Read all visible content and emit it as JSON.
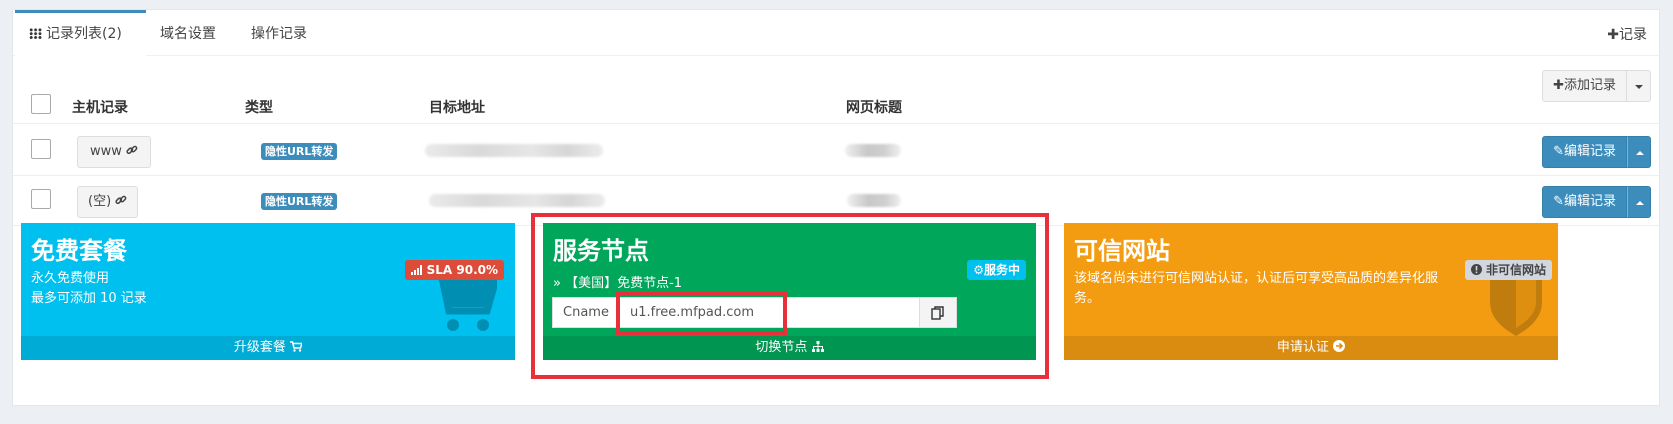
{
  "tabs": {
    "records": "记录列表(2)",
    "domain_settings": "域名设置",
    "operation_log": "操作记录",
    "add_record_link": "记录"
  },
  "table": {
    "headers": [
      "主机记录",
      "类型",
      "目标地址",
      "网页标题"
    ],
    "add_record_button": "添加记录",
    "rows": [
      {
        "host": "www",
        "type": "隐性URL转发",
        "edit_label": "编辑记录"
      },
      {
        "host": "(空)",
        "type": "隐性URL转发",
        "edit_label": "编辑记录"
      }
    ]
  },
  "cards": {
    "free_plan": {
      "title": "免费套餐",
      "line1": "永久免费使用",
      "line2": "最多可添加 10 记录",
      "badge": "SLA 90.0%",
      "footer": "升级套餐",
      "color": "#00c0ef"
    },
    "service_node": {
      "title": "服务节点",
      "node_name": "【美国】免费节点-1",
      "status_badge": "服务中",
      "cname_label": "Cname",
      "cname_value": "u1.free.mfpad.com",
      "footer": "切换节点",
      "color": "#00a65a"
    },
    "trusted_site": {
      "title": "可信网站",
      "desc": "该域名尚未进行可信网站认证，认证后可享受高品质的差异化服务。",
      "badge": "非可信网站",
      "footer": "申请认证",
      "color": "#f39c12"
    }
  },
  "highlight_color": "#e8303a"
}
